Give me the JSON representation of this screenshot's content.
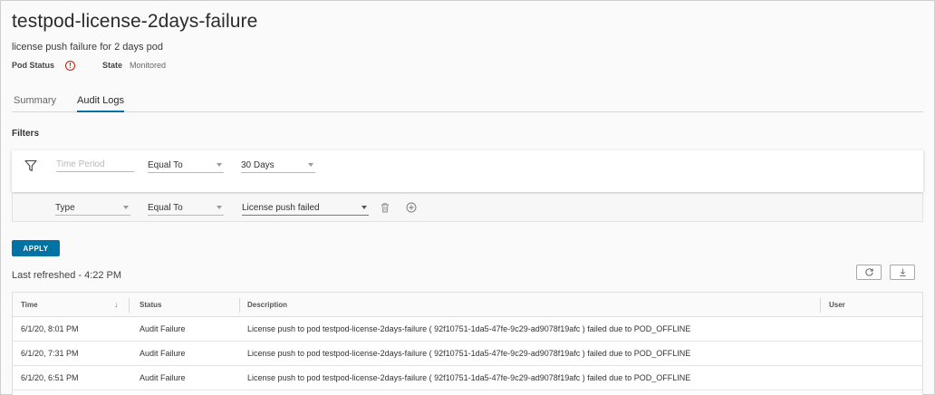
{
  "header": {
    "title": "testpod-license-2days-failure",
    "subtitle": "license push failure for 2 days pod",
    "pod_status_label": "Pod Status",
    "status_icon": "!",
    "state_label": "State",
    "state_value": "Monitored"
  },
  "tabs": [
    {
      "label": "Summary",
      "active": false
    },
    {
      "label": "Audit Logs",
      "active": true
    }
  ],
  "filters": {
    "label": "Filters",
    "row1": {
      "field_placeholder": "Time Period",
      "operator": "Equal To",
      "value": "30 Days"
    },
    "row2": {
      "field": "Type",
      "operator": "Equal To",
      "value": "License push failed"
    }
  },
  "apply_label": "APPLY",
  "last_refreshed": "Last refreshed - 4:22 PM",
  "grid": {
    "columns": [
      "Time",
      "Status",
      "Description",
      "User"
    ],
    "sort_indicator": "↓",
    "rows": [
      {
        "time": "6/1/20, 8:01 PM",
        "status": "Audit Failure",
        "description": "License push to pod testpod-license-2days-failure ( 92f10751-1da5-47fe-9c29-ad9078f19afc ) failed due to POD_OFFLINE",
        "user": ""
      },
      {
        "time": "6/1/20, 7:31 PM",
        "status": "Audit Failure",
        "description": "License push to pod testpod-license-2days-failure ( 92f10751-1da5-47fe-9c29-ad9078f19afc ) failed due to POD_OFFLINE",
        "user": ""
      },
      {
        "time": "6/1/20, 6:51 PM",
        "status": "Audit Failure",
        "description": "License push to pod testpod-license-2days-failure ( 92f10751-1da5-47fe-9c29-ad9078f19afc ) failed due to POD_OFFLINE",
        "user": ""
      }
    ]
  },
  "icons": {
    "status": "exclamation-circle-icon",
    "filter": "funnel-icon",
    "delete": "trash-icon",
    "add": "plus-circle-icon",
    "refresh": "refresh-icon",
    "export": "download-icon"
  },
  "colors": {
    "accent": "#0072a3",
    "error": "#c92100"
  }
}
